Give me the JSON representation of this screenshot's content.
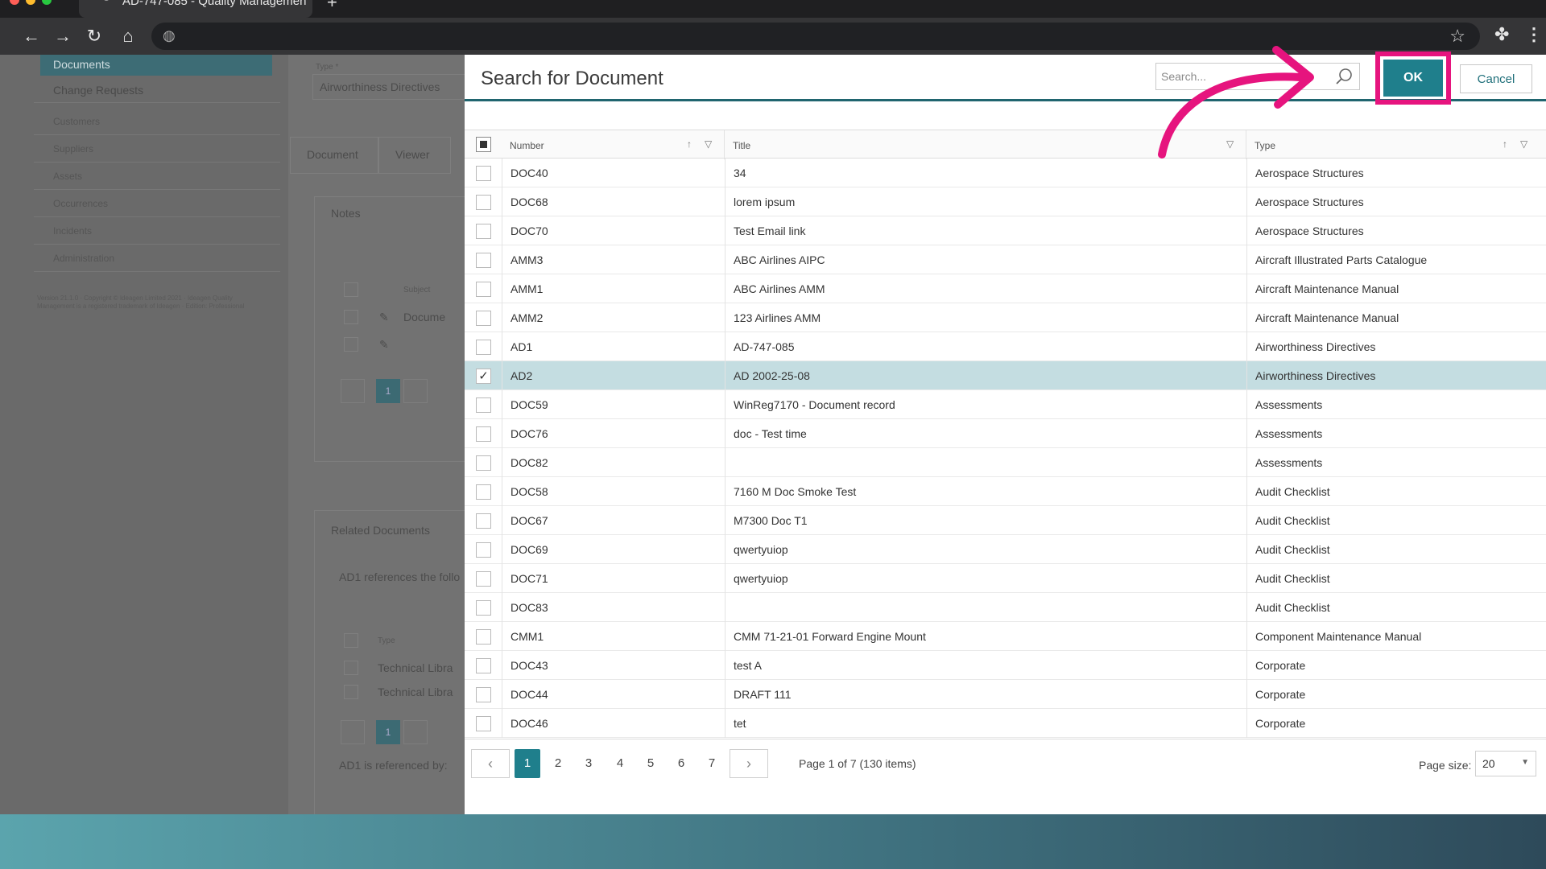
{
  "browser": {
    "tab_title": "AD-747-085 - Quality Managemen",
    "new_tab": "+",
    "back": "←",
    "forward": "→",
    "reload": "↻",
    "home": "⌂"
  },
  "background_app": {
    "sidebar": {
      "active_item": "Documents",
      "items": [
        "Change Requests",
        "Customers",
        "Suppliers",
        "Assets",
        "Occurrences",
        "Incidents",
        "Administration"
      ],
      "footer": "Version 21.1.0 · Copyright © Ideagen Limited 2021 · Ideagen Quality Management is a registered trademark of Ideagen · Edition: Professional"
    },
    "type_label": "Type *",
    "type_value": "Airworthiness Directives",
    "tabs": [
      "Document",
      "Viewer"
    ],
    "notes_title": "Notes",
    "notes_subject_header": "Subject",
    "notes_row": "Docume",
    "notes_page": "1",
    "related_title": "Related Documents",
    "related_text": "AD1 references the follo",
    "related_type_header": "Type",
    "related_rows": [
      "Technical Libra",
      "Technical Libra"
    ],
    "related_page": "1",
    "referenced_by": "AD1 is referenced by:"
  },
  "dialog": {
    "title": "Search for Document",
    "search_placeholder": "Search...",
    "ok_label": "OK",
    "cancel_label": "Cancel",
    "columns": {
      "number": "Number",
      "title": "Title",
      "type": "Type"
    },
    "rows": [
      {
        "number": "DOC40",
        "title": "34",
        "type": "Aerospace Structures",
        "selected": false
      },
      {
        "number": "DOC68",
        "title": "lorem ipsum",
        "type": "Aerospace Structures",
        "selected": false
      },
      {
        "number": "DOC70",
        "title": "Test Email link",
        "type": "Aerospace Structures",
        "selected": false
      },
      {
        "number": "AMM3",
        "title": "ABC Airlines AIPC",
        "type": "Aircraft Illustrated Parts Catalogue",
        "selected": false
      },
      {
        "number": "AMM1",
        "title": "ABC Airlines AMM",
        "type": "Aircraft Maintenance Manual",
        "selected": false
      },
      {
        "number": "AMM2",
        "title": "123 Airlines AMM",
        "type": "Aircraft Maintenance Manual",
        "selected": false
      },
      {
        "number": "AD1",
        "title": "AD-747-085",
        "type": "Airworthiness Directives",
        "selected": false
      },
      {
        "number": "AD2",
        "title": "AD 2002-25-08",
        "type": "Airworthiness Directives",
        "selected": true
      },
      {
        "number": "DOC59",
        "title": "WinReg7170 - Document record",
        "type": "Assessments",
        "selected": false
      },
      {
        "number": "DOC76",
        "title": "doc - Test time",
        "type": "Assessments",
        "selected": false
      },
      {
        "number": "DOC82",
        "title": "",
        "type": "Assessments",
        "selected": false
      },
      {
        "number": "DOC58",
        "title": "7160 M Doc Smoke Test",
        "type": "Audit Checklist",
        "selected": false
      },
      {
        "number": "DOC67",
        "title": "M7300 Doc T1",
        "type": "Audit Checklist",
        "selected": false
      },
      {
        "number": "DOC69",
        "title": "qwertyuiop",
        "type": "Audit Checklist",
        "selected": false
      },
      {
        "number": "DOC71",
        "title": "qwertyuiop",
        "type": "Audit Checklist",
        "selected": false
      },
      {
        "number": "DOC83",
        "title": "",
        "type": "Audit Checklist",
        "selected": false
      },
      {
        "number": "CMM1",
        "title": "CMM 71-21-01 Forward Engine Mount",
        "type": "Component Maintenance Manual",
        "selected": false
      },
      {
        "number": "DOC43",
        "title": "test A",
        "type": "Corporate",
        "selected": false
      },
      {
        "number": "DOC44",
        "title": "DRAFT 111",
        "type": "Corporate",
        "selected": false
      },
      {
        "number": "DOC46",
        "title": "tet",
        "type": "Corporate",
        "selected": false
      }
    ],
    "pager": {
      "pages": [
        "1",
        "2",
        "3",
        "4",
        "5",
        "6",
        "7"
      ],
      "current_page": "1",
      "prev": "‹",
      "next": "›",
      "info": "Page 1 of 7 (130 items)",
      "page_size_label": "Page size:",
      "page_size_value": "20"
    }
  },
  "annotation": {
    "highlight_color": "#e6147e"
  },
  "colors": {
    "accent": "#1f7f8c",
    "selected_row": "#c4dde1"
  }
}
